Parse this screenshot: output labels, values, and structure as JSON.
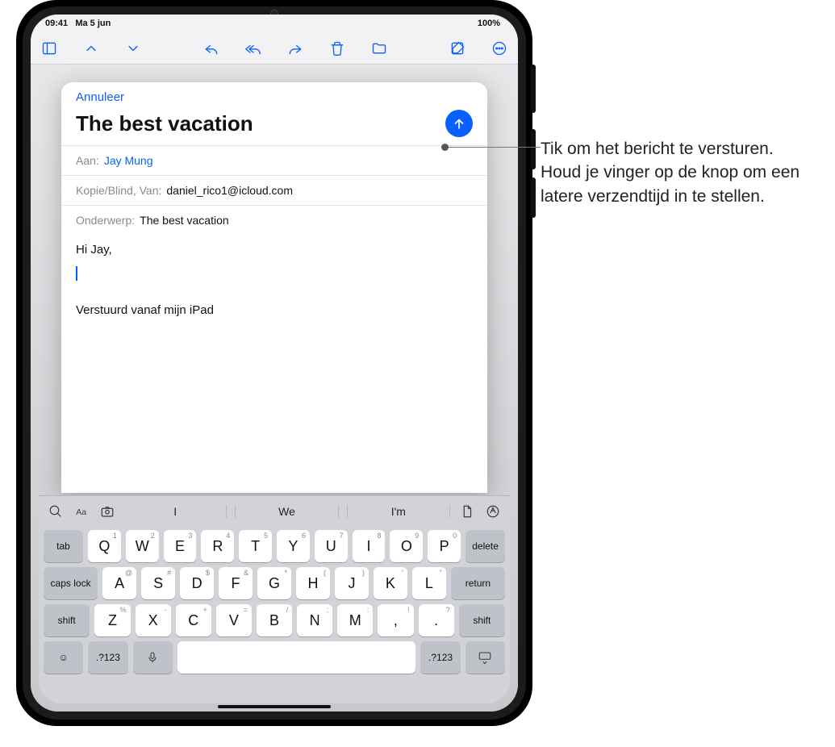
{
  "status": {
    "time": "09:41",
    "date": "Ma 5 jun",
    "battery_pct": "100%"
  },
  "compose": {
    "cancel": "Annuleer",
    "title": "The best vacation",
    "to_label": "Aan:",
    "to_value": "Jay Mung",
    "cc_label": "Kopie/Blind, Van:",
    "cc_value": "daniel_rico1@icloud.com",
    "subject_label": "Onderwerp:",
    "subject_value": "The best vacation",
    "body_greeting": "Hi Jay,",
    "signature": "Verstuurd vanaf mijn iPad"
  },
  "keyboard": {
    "suggestions": [
      "I",
      "We",
      "I'm"
    ],
    "row1": [
      {
        "k": "Q",
        "a": "1"
      },
      {
        "k": "W",
        "a": "2"
      },
      {
        "k": "E",
        "a": "3"
      },
      {
        "k": "R",
        "a": "4"
      },
      {
        "k": "T",
        "a": "5"
      },
      {
        "k": "Y",
        "a": "6"
      },
      {
        "k": "U",
        "a": "7"
      },
      {
        "k": "I",
        "a": "8"
      },
      {
        "k": "O",
        "a": "9"
      },
      {
        "k": "P",
        "a": "0"
      }
    ],
    "row2": [
      {
        "k": "A",
        "a": "@"
      },
      {
        "k": "S",
        "a": "#"
      },
      {
        "k": "D",
        "a": "$"
      },
      {
        "k": "F",
        "a": "&"
      },
      {
        "k": "G",
        "a": "*"
      },
      {
        "k": "H",
        "a": "("
      },
      {
        "k": "J",
        "a": ")"
      },
      {
        "k": "K",
        "a": "'"
      },
      {
        "k": "L",
        "a": "\""
      }
    ],
    "row3": [
      {
        "k": "Z",
        "a": "%"
      },
      {
        "k": "X",
        "a": "-"
      },
      {
        "k": "C",
        "a": "+"
      },
      {
        "k": "V",
        "a": "="
      },
      {
        "k": "B",
        "a": "/"
      },
      {
        "k": "N",
        "a": ";"
      },
      {
        "k": "M",
        "a": ":"
      },
      {
        "k": ",",
        "a": "!"
      },
      {
        "k": ".",
        "a": "?"
      }
    ],
    "tab": "tab",
    "delete": "delete",
    "caps": "caps lock",
    "return": "return",
    "shift": "shift",
    "numkey": ".?123"
  },
  "callout": "Tik om het bericht te versturen. Houd je vinger op de knop om een latere verzendtijd in te stellen."
}
